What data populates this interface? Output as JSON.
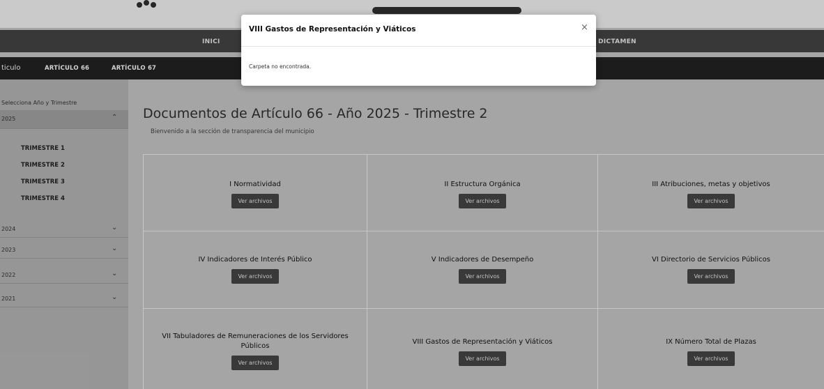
{
  "topnav": {
    "item_partial_left": "INICI",
    "item_right": "DICTAMEN"
  },
  "subnav": {
    "item_partial": "ticulo",
    "item_66": "ARTÍCULO 66",
    "item_67": "ARTÍCULO 67"
  },
  "sidebar": {
    "title": "Selecciona Año y Trimestre",
    "open_year": "2025",
    "trimestres": [
      "TRIMESTRE 1",
      "TRIMESTRE 2",
      "TRIMESTRE 3",
      "TRIMESTRE 4"
    ],
    "years": [
      "2024",
      "2023",
      "2022",
      "2021"
    ]
  },
  "main": {
    "title": "Documentos de Artículo 66 - Año 2025 - Trimestre 2",
    "subtitle": "Bienvenido a la sección de transparencia del municipio",
    "button_label": "Ver archivos",
    "cards": [
      "I Normatividad",
      "II Estructura Orgánica",
      "III Atribuciones, metas y objetivos",
      "IV Indicadores de Interés Público",
      "V Indicadores de Desempeño",
      "VI Directorio de Servicios Públicos",
      "VII Tabuladores de Remuneraciones de los Servidores Públicos",
      "VIII Gastos de Representación y Viáticos",
      "IX Número Total de Plazas"
    ]
  },
  "modal": {
    "title": "VIII Gastos de Representación y Viáticos",
    "close_glyph": "×",
    "body": "Carpeta no encontrada."
  }
}
